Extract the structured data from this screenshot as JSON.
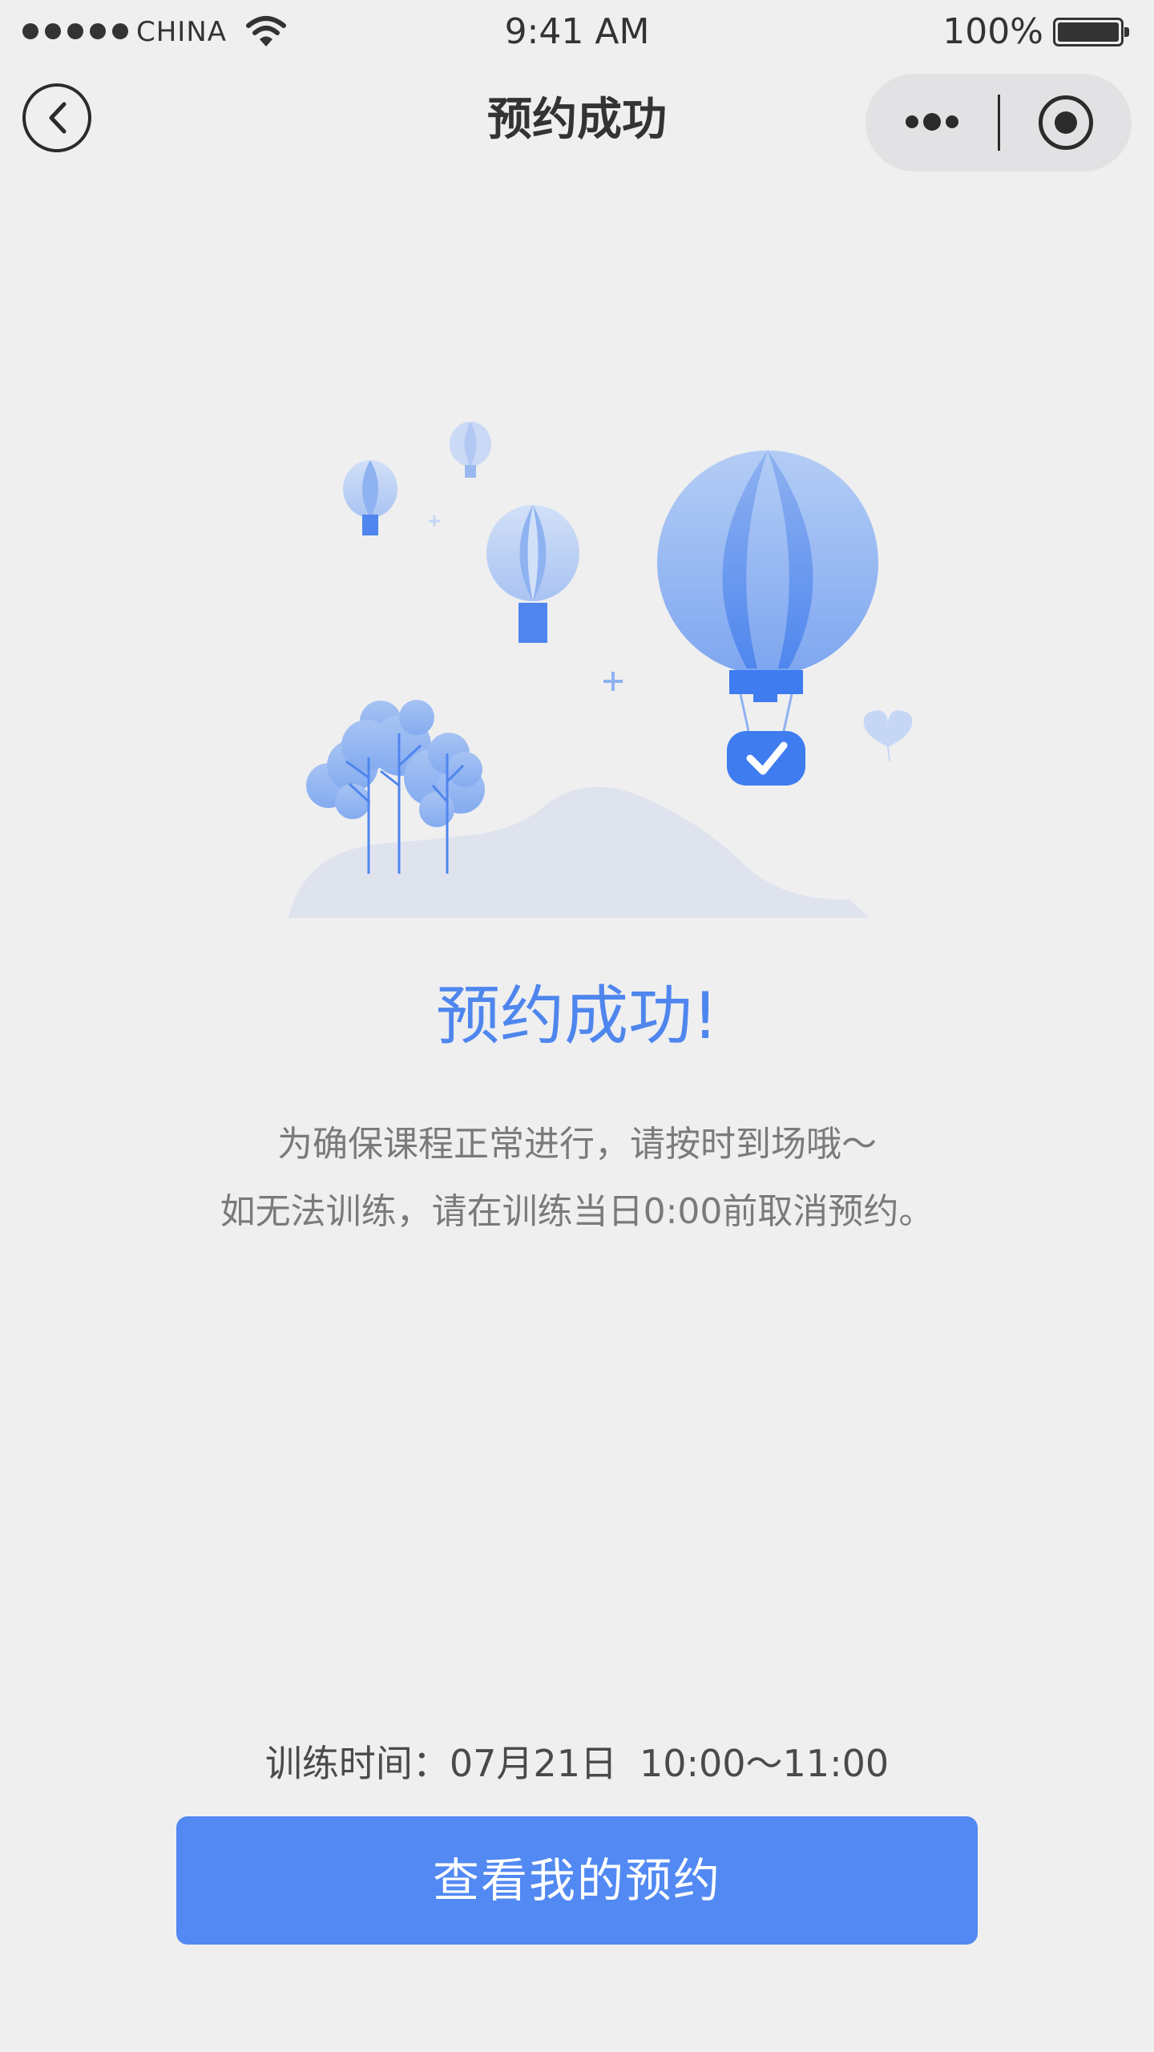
{
  "status_bar": {
    "carrier": "CHINA",
    "time": "9:41 AM",
    "battery_percent": "100%",
    "battery_level": 1.0,
    "signal_bars": 5
  },
  "nav_bar": {
    "title": "预约成功",
    "back_icon": "chevron-left-icon",
    "more_icon": "more-dots-icon",
    "close_icon": "target-close-icon"
  },
  "result": {
    "heading": "预约成功!",
    "message_lines": [
      "为确保课程正常进行，请按时到场哦～",
      "如无法训练，请在训练当日0:00前取消预约。"
    ]
  },
  "booking": {
    "label": "训练时间：",
    "date": "07月21日",
    "time_range": "10:00～11:00"
  },
  "actions": {
    "view_bookings_label": "查看我的预约"
  },
  "colors": {
    "background": "#efeff0",
    "accent": "#4f86ee",
    "button": "#5289f2",
    "text_primary": "#333333",
    "text_secondary": "#7a7a7a"
  }
}
